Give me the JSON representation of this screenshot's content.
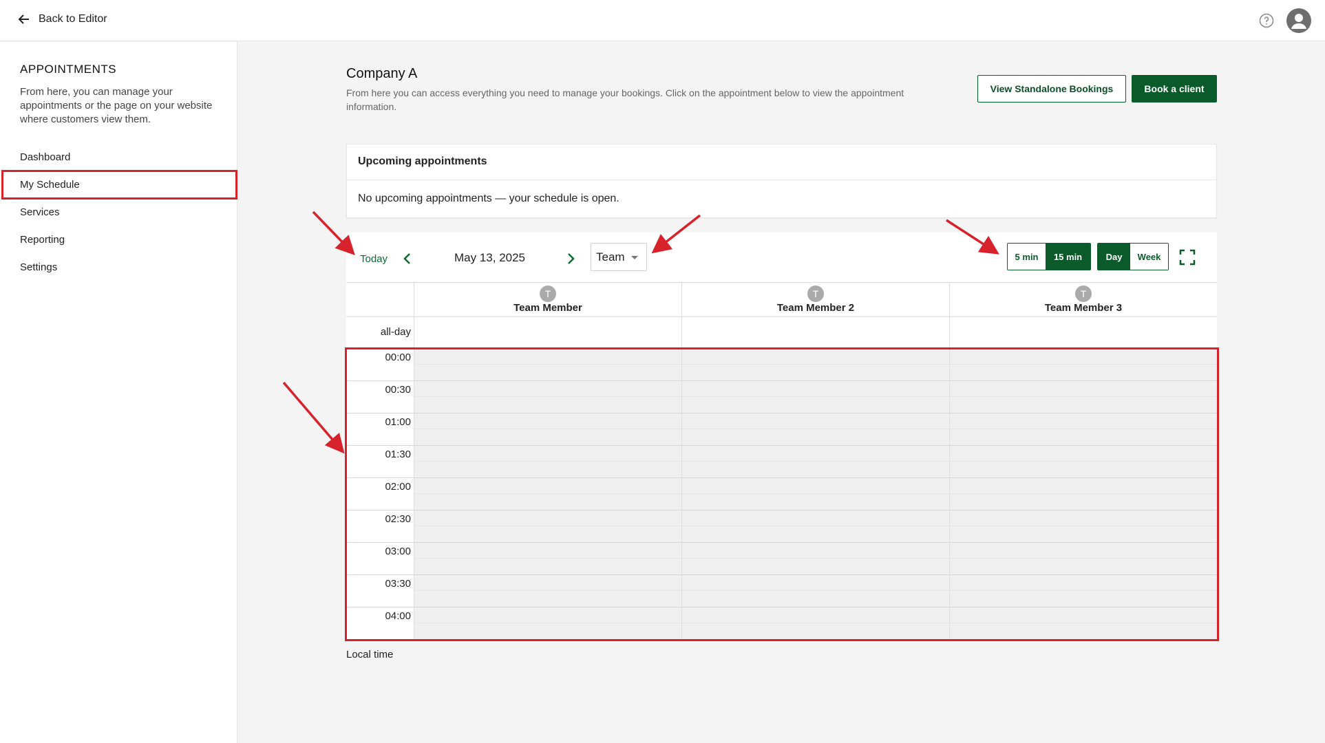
{
  "topbar": {
    "back_label": "Back to Editor"
  },
  "sidebar": {
    "title": "APPOINTMENTS",
    "description": "From here, you can manage your appointments or the page on your website where customers view them.",
    "items": [
      {
        "label": "Dashboard"
      },
      {
        "label": "My Schedule",
        "active": true
      },
      {
        "label": "Services"
      },
      {
        "label": "Reporting"
      },
      {
        "label": "Settings"
      }
    ]
  },
  "header": {
    "title": "Company A",
    "description": "From here you can access everything you need to manage your bookings. Click on the appointment below to view the appointment information.",
    "view_standalone_label": "View Standalone Bookings",
    "book_client_label": "Book a client"
  },
  "upcoming": {
    "title": "Upcoming appointments",
    "message": "No upcoming appointments — your schedule is open."
  },
  "calendar": {
    "today_label": "Today",
    "date": "May 13, 2025",
    "view_select": "Team",
    "interval_options": [
      "5 min",
      "15 min"
    ],
    "interval_selected": "15 min",
    "range_options": [
      "Day",
      "Week"
    ],
    "range_selected": "Day",
    "columns": [
      {
        "initial": "T",
        "name": "Team Member"
      },
      {
        "initial": "T",
        "name": "Team Member 2"
      },
      {
        "initial": "T",
        "name": "Team Member 3"
      }
    ],
    "allday_label": "all-day",
    "times": [
      "00:00",
      "00:30",
      "01:00",
      "01:30",
      "02:00",
      "02:30",
      "03:00",
      "03:30",
      "04:00"
    ],
    "footer_label": "Local time"
  },
  "colors": {
    "accent": "#0a5a2a",
    "annotation": "#d7212b"
  }
}
